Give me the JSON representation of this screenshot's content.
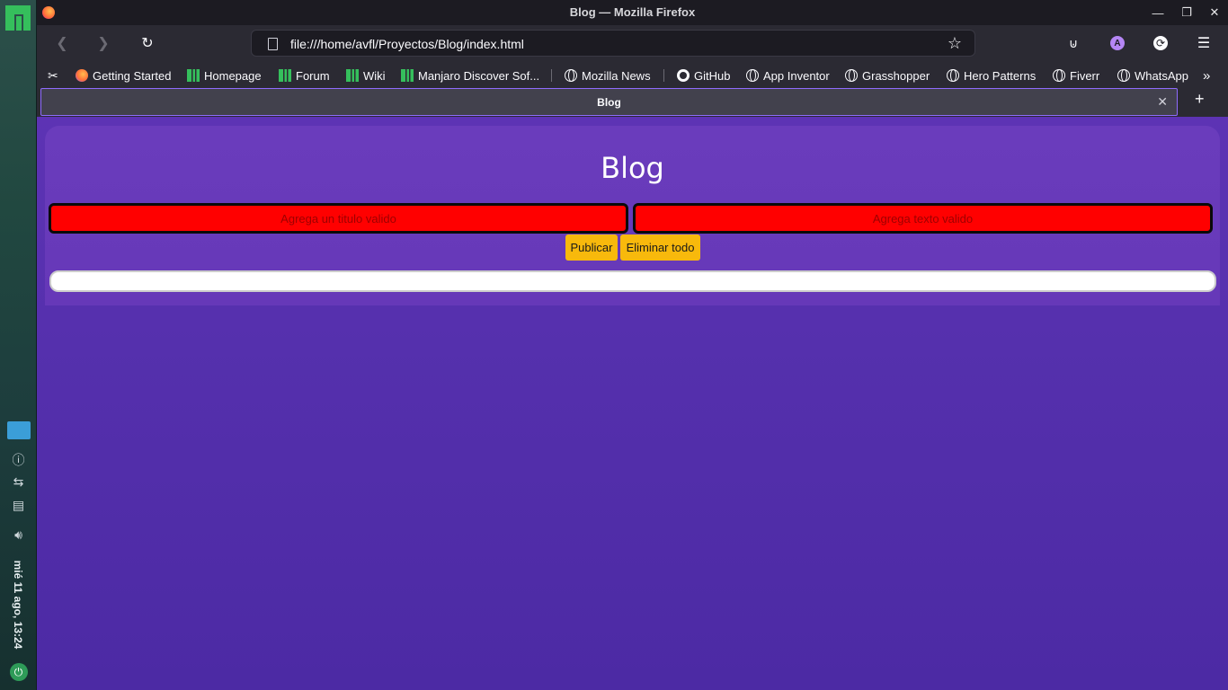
{
  "desktop": {
    "clock": "mié 11 ago, 13:24"
  },
  "browser": {
    "window_title": "Blog — Mozilla Firefox",
    "url": "file:///home/avfl/Proyectos/Blog/index.html",
    "account_initial": "A",
    "bookmarks": [
      {
        "label": "Getting Started",
        "icon": "firefox-icon"
      },
      {
        "label": "Homepage",
        "icon": "manjaro-icon"
      },
      {
        "label": "Forum",
        "icon": "manjaro-icon"
      },
      {
        "label": "Wiki",
        "icon": "manjaro-icon"
      },
      {
        "label": "Manjaro Discover Sof...",
        "icon": "manjaro-icon"
      },
      {
        "label": "Mozilla News",
        "icon": "globe-icon"
      },
      {
        "label": "GitHub",
        "icon": "github-icon"
      },
      {
        "label": "App Inventor",
        "icon": "globe-icon"
      },
      {
        "label": "Grasshopper",
        "icon": "globe-icon"
      },
      {
        "label": "Hero Patterns",
        "icon": "globe-icon"
      },
      {
        "label": "Fiverr",
        "icon": "globe-icon"
      },
      {
        "label": "WhatsApp",
        "icon": "globe-icon"
      }
    ],
    "tab": {
      "label": "Blog"
    }
  },
  "page": {
    "title": "Blog",
    "title_placeholder": "Agrega un titulo valido",
    "text_placeholder": "Agrega texto valido",
    "publish_label": "Publicar",
    "delete_all_label": "Eliminar todo"
  },
  "colors": {
    "background": "#5530ad",
    "card": "#6a3cbc",
    "error_input": "#ff0000",
    "button": "#f8b90c"
  }
}
